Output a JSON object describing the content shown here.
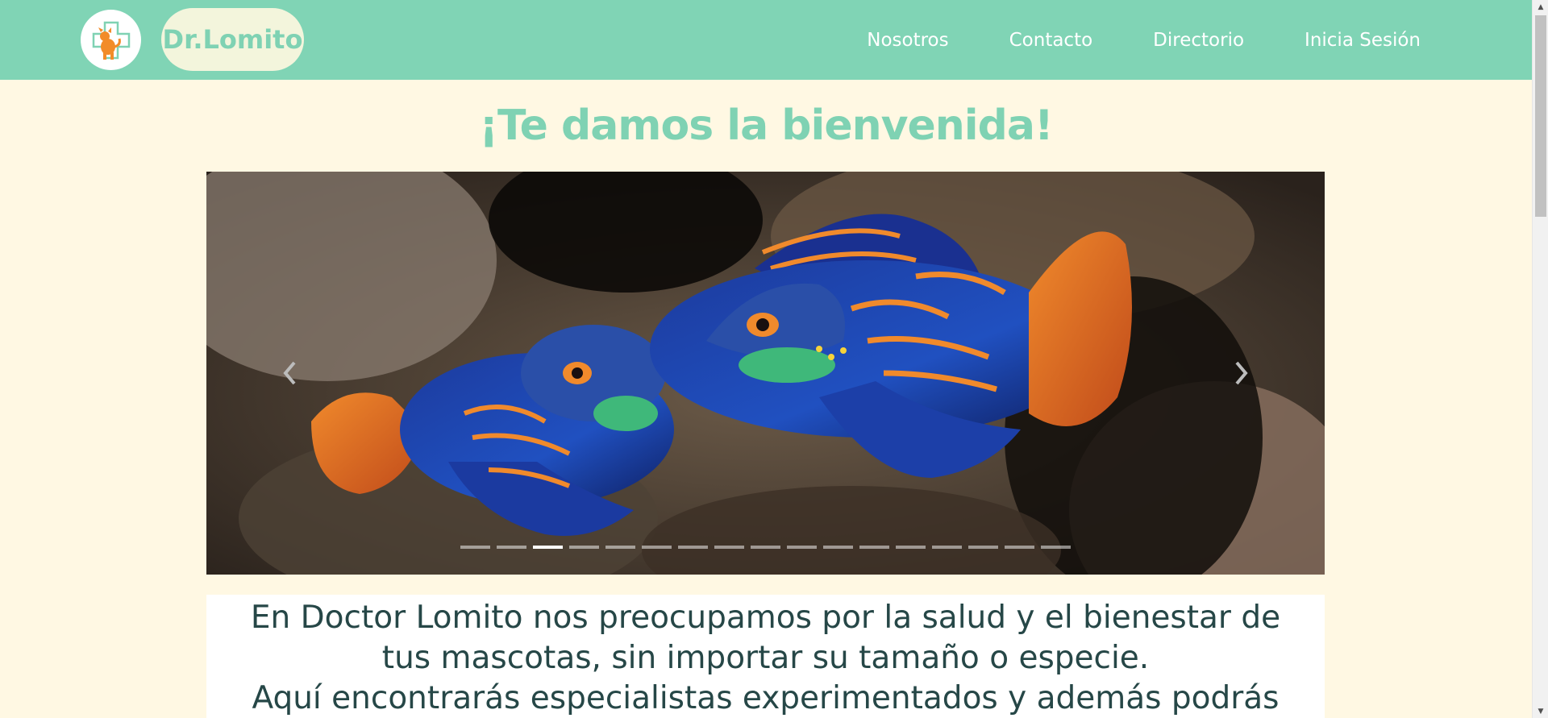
{
  "header": {
    "brand": "Dr.Lomito",
    "logo_icon": "dog-cross-logo-icon",
    "nav": [
      {
        "label": "Nosotros"
      },
      {
        "label": "Contacto"
      },
      {
        "label": "Directorio"
      },
      {
        "label": "Inicia Sesión"
      }
    ]
  },
  "main": {
    "heading": "¡Te damos la bienvenida!",
    "carousel": {
      "prev_icon": "chevron-left-icon",
      "next_icon": "chevron-right-icon",
      "slide_count": 17,
      "active_index": 2
    },
    "intro_lines": [
      "En Doctor Lomito nos preocupamos por la salud y el bienestar de",
      "tus mascotas, sin importar su tamaño o especie.",
      "Aquí encontrarás especialistas experimentados y además podrás"
    ]
  },
  "colors": {
    "header_bg": "#80d4b5",
    "page_bg": "#fff8e3",
    "accent": "#7fd2b3",
    "text_dark": "#264747"
  }
}
